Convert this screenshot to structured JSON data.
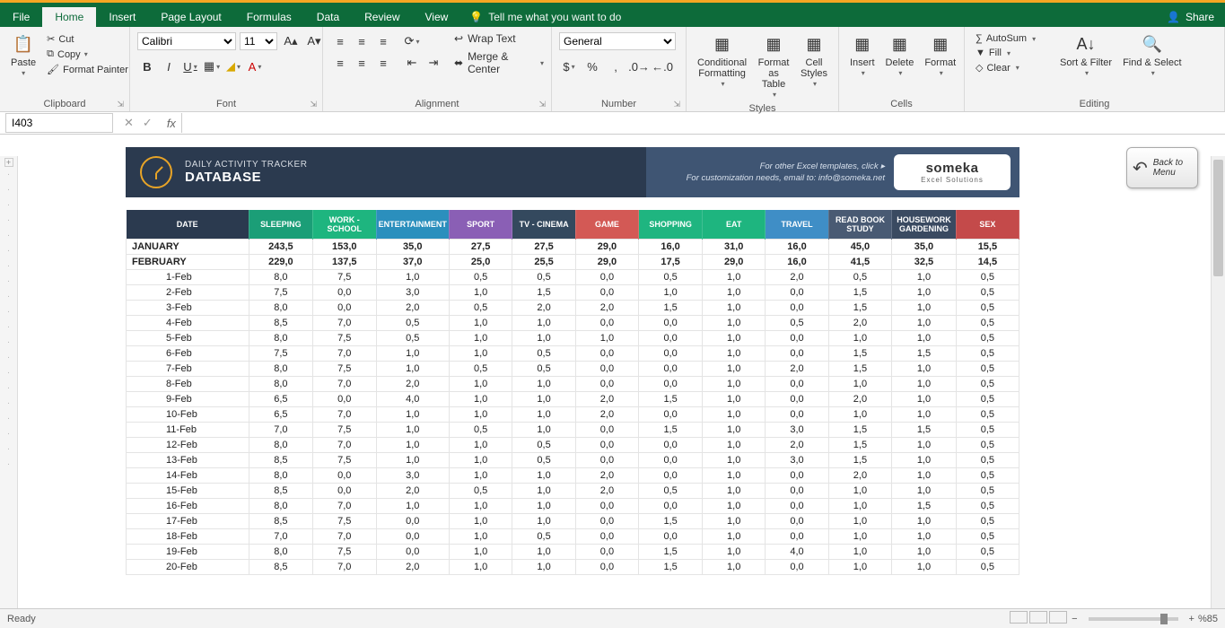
{
  "app": {
    "share": "Share",
    "tell": "Tell me what you want to do"
  },
  "tabs": [
    "File",
    "Home",
    "Insert",
    "Page Layout",
    "Formulas",
    "Data",
    "Review",
    "View"
  ],
  "active_tab": "Home",
  "ribbon": {
    "clipboard": {
      "label": "Clipboard",
      "paste": "Paste",
      "cut": "Cut",
      "copy": "Copy",
      "painter": "Format Painter"
    },
    "font": {
      "label": "Font",
      "name": "Calibri",
      "size": "11"
    },
    "alignment": {
      "label": "Alignment",
      "wrap": "Wrap Text",
      "merge": "Merge & Center"
    },
    "number": {
      "label": "Number",
      "format": "General"
    },
    "styles": {
      "label": "Styles",
      "cond": "Conditional Formatting",
      "table": "Format as Table",
      "cell": "Cell Styles"
    },
    "cells": {
      "label": "Cells",
      "insert": "Insert",
      "delete": "Delete",
      "format": "Format"
    },
    "editing": {
      "label": "Editing",
      "autosum": "AutoSum",
      "fill": "Fill",
      "clear": "Clear",
      "sort": "Sort & Filter",
      "find": "Find & Select"
    }
  },
  "formulabar": {
    "cell": "I403",
    "formula": ""
  },
  "banner": {
    "title1": "DAILY ACTIVITY TRACKER",
    "title2": "DATABASE",
    "meta1": "For other Excel templates, click ▸",
    "meta2": "For customization needs, email to: info@someka.net",
    "logo": "someka",
    "logosub": "Excel Solutions",
    "back": "Back to Menu"
  },
  "columns": [
    {
      "label": "DATE",
      "color": "#2b3a4f"
    },
    {
      "label": "SLEEPING",
      "color": "#1b9e77"
    },
    {
      "label": "WORK - SCHOOL",
      "color": "#1eb57f"
    },
    {
      "label": "ENTERTAINMENT",
      "color": "#2b8fbd"
    },
    {
      "label": "SPORT",
      "color": "#8a5fb5"
    },
    {
      "label": "TV - CINEMA",
      "color": "#34495e"
    },
    {
      "label": "GAME",
      "color": "#d35955"
    },
    {
      "label": "SHOPPING",
      "color": "#1fb580"
    },
    {
      "label": "EAT",
      "color": "#1eb57f"
    },
    {
      "label": "TRAVEL",
      "color": "#3f8ec6"
    },
    {
      "label": "READ BOOK STUDY",
      "color": "#495a73"
    },
    {
      "label": "HOUSEWORK GARDENING",
      "color": "#3a4a61"
    },
    {
      "label": "SEX",
      "color": "#c44a4a"
    }
  ],
  "summaries": [
    {
      "label": "JANUARY",
      "vals": [
        "243,5",
        "153,0",
        "35,0",
        "27,5",
        "27,5",
        "29,0",
        "16,0",
        "31,0",
        "16,0",
        "45,0",
        "35,0",
        "15,5"
      ]
    },
    {
      "label": "FEBRUARY",
      "vals": [
        "229,0",
        "137,5",
        "37,0",
        "25,0",
        "25,5",
        "29,0",
        "17,5",
        "29,0",
        "16,0",
        "41,5",
        "32,5",
        "14,5"
      ]
    }
  ],
  "rows": [
    {
      "d": "1-Feb",
      "v": [
        "8,0",
        "7,5",
        "1,0",
        "0,5",
        "0,5",
        "0,0",
        "0,5",
        "1,0",
        "2,0",
        "0,5",
        "1,0",
        "0,5"
      ]
    },
    {
      "d": "2-Feb",
      "v": [
        "7,5",
        "0,0",
        "3,0",
        "1,0",
        "1,5",
        "0,0",
        "1,0",
        "1,0",
        "0,0",
        "1,5",
        "1,0",
        "0,5"
      ]
    },
    {
      "d": "3-Feb",
      "v": [
        "8,0",
        "0,0",
        "2,0",
        "0,5",
        "2,0",
        "2,0",
        "1,5",
        "1,0",
        "0,0",
        "1,5",
        "1,0",
        "0,5"
      ]
    },
    {
      "d": "4-Feb",
      "v": [
        "8,5",
        "7,0",
        "0,5",
        "1,0",
        "1,0",
        "0,0",
        "0,0",
        "1,0",
        "0,5",
        "2,0",
        "1,0",
        "0,5"
      ]
    },
    {
      "d": "5-Feb",
      "v": [
        "8,0",
        "7,5",
        "0,5",
        "1,0",
        "1,0",
        "1,0",
        "0,0",
        "1,0",
        "0,0",
        "1,0",
        "1,0",
        "0,5"
      ]
    },
    {
      "d": "6-Feb",
      "v": [
        "7,5",
        "7,0",
        "1,0",
        "1,0",
        "0,5",
        "0,0",
        "0,0",
        "1,0",
        "0,0",
        "1,5",
        "1,5",
        "0,5"
      ]
    },
    {
      "d": "7-Feb",
      "v": [
        "8,0",
        "7,5",
        "1,0",
        "0,5",
        "0,5",
        "0,0",
        "0,0",
        "1,0",
        "2,0",
        "1,5",
        "1,0",
        "0,5"
      ]
    },
    {
      "d": "8-Feb",
      "v": [
        "8,0",
        "7,0",
        "2,0",
        "1,0",
        "1,0",
        "0,0",
        "0,0",
        "1,0",
        "0,0",
        "1,0",
        "1,0",
        "0,5"
      ]
    },
    {
      "d": "9-Feb",
      "v": [
        "6,5",
        "0,0",
        "4,0",
        "1,0",
        "1,0",
        "2,0",
        "1,5",
        "1,0",
        "0,0",
        "2,0",
        "1,0",
        "0,5"
      ]
    },
    {
      "d": "10-Feb",
      "v": [
        "6,5",
        "7,0",
        "1,0",
        "1,0",
        "1,0",
        "2,0",
        "0,0",
        "1,0",
        "0,0",
        "1,0",
        "1,0",
        "0,5"
      ]
    },
    {
      "d": "11-Feb",
      "v": [
        "7,0",
        "7,5",
        "1,0",
        "0,5",
        "1,0",
        "0,0",
        "1,5",
        "1,0",
        "3,0",
        "1,5",
        "1,5",
        "0,5"
      ]
    },
    {
      "d": "12-Feb",
      "v": [
        "8,0",
        "7,0",
        "1,0",
        "1,0",
        "0,5",
        "0,0",
        "0,0",
        "1,0",
        "2,0",
        "1,5",
        "1,0",
        "0,5"
      ]
    },
    {
      "d": "13-Feb",
      "v": [
        "8,5",
        "7,5",
        "1,0",
        "1,0",
        "0,5",
        "0,0",
        "0,0",
        "1,0",
        "3,0",
        "1,5",
        "1,0",
        "0,5"
      ]
    },
    {
      "d": "14-Feb",
      "v": [
        "8,0",
        "0,0",
        "3,0",
        "1,0",
        "1,0",
        "2,0",
        "0,0",
        "1,0",
        "0,0",
        "2,0",
        "1,0",
        "0,5"
      ]
    },
    {
      "d": "15-Feb",
      "v": [
        "8,5",
        "0,0",
        "2,0",
        "0,5",
        "1,0",
        "2,0",
        "0,5",
        "1,0",
        "0,0",
        "1,0",
        "1,0",
        "0,5"
      ]
    },
    {
      "d": "16-Feb",
      "v": [
        "8,0",
        "7,0",
        "1,0",
        "1,0",
        "1,0",
        "0,0",
        "0,0",
        "1,0",
        "0,0",
        "1,0",
        "1,5",
        "0,5"
      ]
    },
    {
      "d": "17-Feb",
      "v": [
        "8,5",
        "7,5",
        "0,0",
        "1,0",
        "1,0",
        "0,0",
        "1,5",
        "1,0",
        "0,0",
        "1,0",
        "1,0",
        "0,5"
      ]
    },
    {
      "d": "18-Feb",
      "v": [
        "7,0",
        "7,0",
        "0,0",
        "1,0",
        "0,5",
        "0,0",
        "0,0",
        "1,0",
        "0,0",
        "1,0",
        "1,0",
        "0,5"
      ]
    },
    {
      "d": "19-Feb",
      "v": [
        "8,0",
        "7,5",
        "0,0",
        "1,0",
        "1,0",
        "0,0",
        "1,5",
        "1,0",
        "4,0",
        "1,0",
        "1,0",
        "0,5"
      ]
    },
    {
      "d": "20-Feb",
      "v": [
        "8,5",
        "7,0",
        "2,0",
        "1,0",
        "1,0",
        "0,0",
        "1,5",
        "1,0",
        "0,0",
        "1,0",
        "1,0",
        "0,5"
      ]
    }
  ],
  "status": {
    "ready": "Ready",
    "zoom": "%85"
  }
}
